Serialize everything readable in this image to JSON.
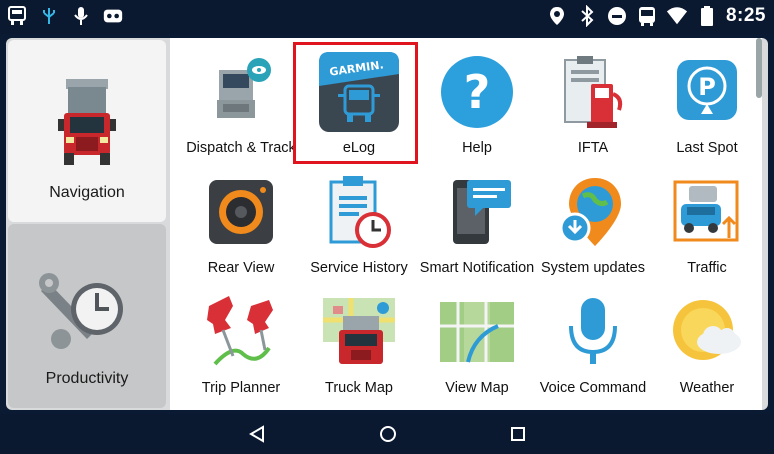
{
  "status_bar": {
    "time": "8:25",
    "left_icons": [
      "truck-icon",
      "usb-debug-icon",
      "microphone-icon",
      "voicemail-icon"
    ],
    "right_icons": [
      "location-pin-icon",
      "bluetooth-icon",
      "do-not-disturb-icon",
      "bus-icon",
      "wifi-icon",
      "battery-icon"
    ]
  },
  "sidebar": {
    "items": [
      {
        "label": "Navigation",
        "icon": "red-truck-icon",
        "active": true
      },
      {
        "label": "Productivity",
        "icon": "wrench-clock-icon",
        "active": false
      }
    ]
  },
  "apps": [
    {
      "label": "Dispatch & Track",
      "icon": "dispatch-truck-icon"
    },
    {
      "label": "eLog",
      "icon": "garmin-elog-icon",
      "brand_text": "GARMIN.",
      "highlighted": true
    },
    {
      "label": "Help",
      "icon": "help-question-icon"
    },
    {
      "label": "IFTA",
      "icon": "ifta-fuel-icon"
    },
    {
      "label": "Last Spot",
      "icon": "parking-pin-icon"
    },
    {
      "label": "Rear View",
      "icon": "rear-camera-icon"
    },
    {
      "label": "Service History",
      "icon": "service-clipboard-icon"
    },
    {
      "label": "Smart Notification",
      "icon": "phone-message-icon"
    },
    {
      "label": "System updates",
      "icon": "globe-download-icon"
    },
    {
      "label": "Traffic",
      "icon": "traffic-cars-icon"
    },
    {
      "label": "Trip Planner",
      "icon": "pushpins-icon"
    },
    {
      "label": "Truck Map",
      "icon": "truck-map-icon"
    },
    {
      "label": "View Map",
      "icon": "view-map-icon"
    },
    {
      "label": "Voice Command",
      "icon": "microphone-blue-icon"
    },
    {
      "label": "Weather",
      "icon": "sun-cloud-icon"
    }
  ],
  "nav_buttons": [
    "back-icon",
    "home-icon",
    "recents-icon"
  ],
  "colors": {
    "highlight": "#e0141e",
    "accent_blue": "#2f9bd6"
  }
}
